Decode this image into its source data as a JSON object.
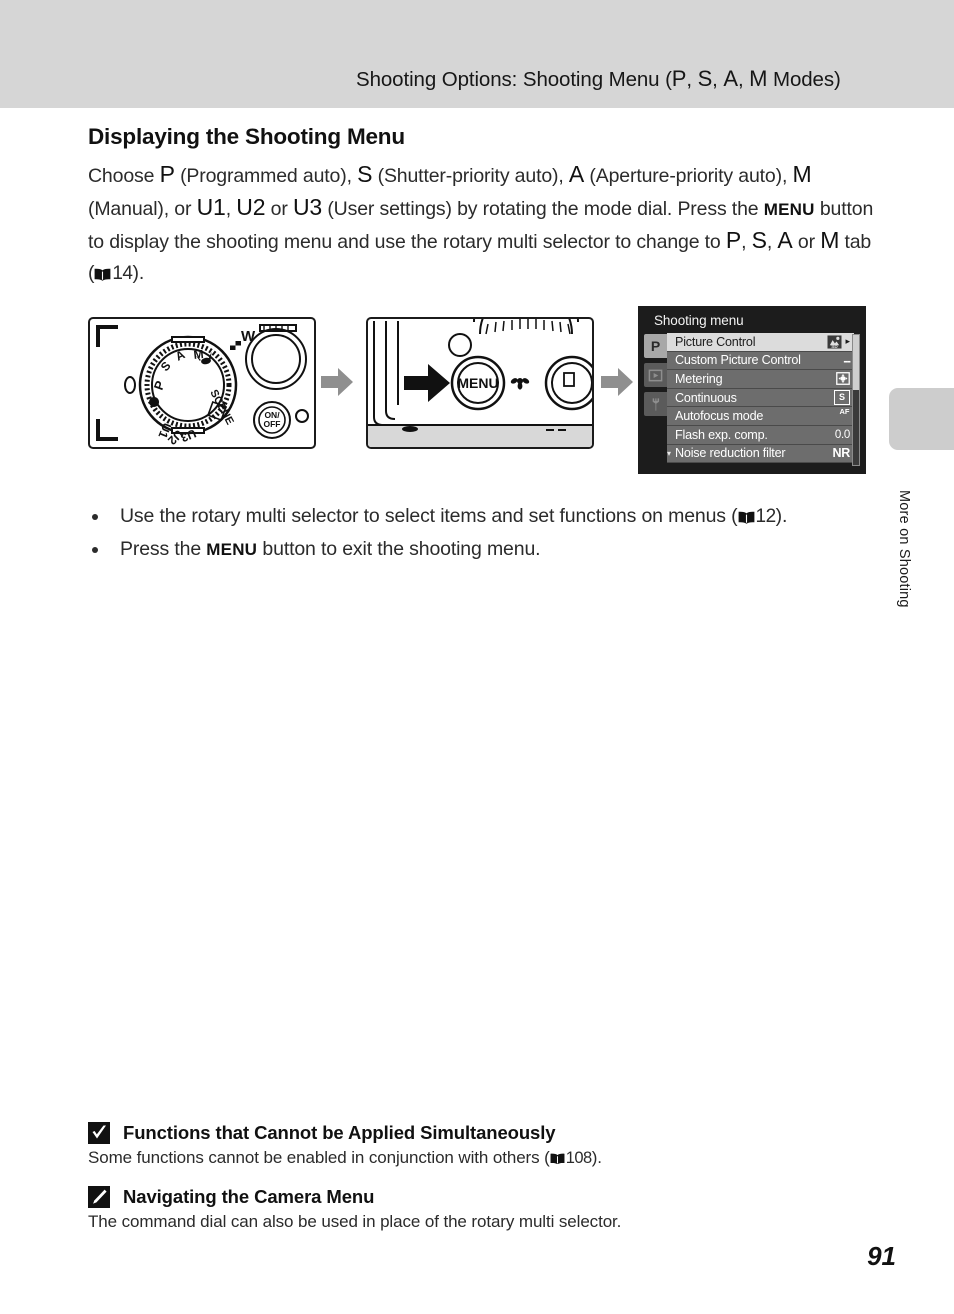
{
  "header": {
    "title_prefix": "Shooting Options: Shooting Menu (",
    "mode_p": "P",
    "sep1": ", ",
    "mode_s": "S",
    "sep2": ", ",
    "mode_a": "A",
    "sep3": ", ",
    "mode_m": "M",
    "title_suffix": " Modes)"
  },
  "section": {
    "title": "Displaying the Shooting Menu",
    "para": {
      "t1": "Choose ",
      "g1": "P",
      "t2": " (Programmed auto), ",
      "g2": "S",
      "t3": " (Shutter-priority auto), ",
      "g3": "A",
      "t4": " (Aperture-priority auto), ",
      "g4": "M",
      "t5": " (Manual), or ",
      "g5": "U1",
      "t6": ", ",
      "g6": "U2",
      "t7": " or ",
      "g7": "U3",
      "t8": " (User settings) by rotating the mode dial. Press the ",
      "g8": "MENU",
      "t9": " button to display the shooting menu and use the rotary multi selector to change to ",
      "g9": "P",
      "t10": ", ",
      "g10": "S",
      "t11": ", ",
      "g11": "A",
      "t12": " or ",
      "g12": "M",
      "t13": " tab (",
      "ref": "14",
      "t14": ")."
    }
  },
  "figure": {
    "dial_labels": {
      "p": "P",
      "s": "S",
      "a": "A",
      "m": "M",
      "scene": "SCENE",
      "u1": "U1",
      "u2": "U2",
      "u3": "U3"
    },
    "power_label_top": "ON/",
    "power_label_bottom": "OFF",
    "zoom_w": "W",
    "menu_button_label": "MENU",
    "arrow_icon": "right-arrow"
  },
  "menu_screen": {
    "title": "Shooting menu",
    "tabs": [
      {
        "name": "shooting-tab",
        "glyph": "P",
        "active": true
      },
      {
        "name": "playback-tab",
        "glyph": "▶",
        "active": false
      },
      {
        "name": "setup-tab",
        "glyph": "Ɣ",
        "active": false
      }
    ],
    "rows": [
      {
        "label": "Picture Control",
        "value": "picture-control-icon",
        "value_kind": "icon-pc",
        "selected": true,
        "caret": "▸"
      },
      {
        "label": "Custom Picture Control",
        "value": "--",
        "value_kind": "dashes",
        "selected": false,
        "caret": ""
      },
      {
        "label": "Metering",
        "value": "matrix-metering-icon",
        "value_kind": "icon-meter",
        "selected": false,
        "caret": ""
      },
      {
        "label": "Continuous",
        "value": "S",
        "value_kind": "box",
        "selected": false,
        "caret": ""
      },
      {
        "label": "Autofocus mode",
        "value": "AF-S",
        "value_kind": "afs",
        "selected": false,
        "caret": ""
      },
      {
        "label": "Flash exp. comp.",
        "value": "0.0",
        "value_kind": "num",
        "selected": false,
        "caret": ""
      },
      {
        "label": "Noise reduction filter",
        "value": "NR",
        "value_kind": "nr",
        "selected": false,
        "caret": ""
      }
    ],
    "scroll_hint": "▾"
  },
  "bullets": [
    {
      "t1": "Use the rotary multi selector to select items and set functions on menus (",
      "ref": "12",
      "t2": ")."
    },
    {
      "t1": "Press the ",
      "g1": "MENU",
      "t2": " button to exit the shooting menu."
    }
  ],
  "side_tab": {
    "label": "More on Shooting"
  },
  "notes": [
    {
      "icon": "checkmark-icon",
      "title": "Functions that Cannot be Applied Simultaneously",
      "body_t1": "Some functions cannot be enabled in conjunction with others (",
      "body_ref": "108",
      "body_t2": ")."
    },
    {
      "icon": "pencil-icon",
      "title": "Navigating the Camera Menu",
      "body_t1": "The command dial can also be used in place of the rotary multi selector.",
      "body_ref": "",
      "body_t2": ""
    }
  ],
  "page_number": "91",
  "colors": {
    "header_band": "#d6d6d6",
    "menu_bg": "#1c1c1c",
    "menu_row": "#6d6d6d",
    "menu_row_selected": "#dcdcdc",
    "side_tab": "#cdcdcd"
  }
}
